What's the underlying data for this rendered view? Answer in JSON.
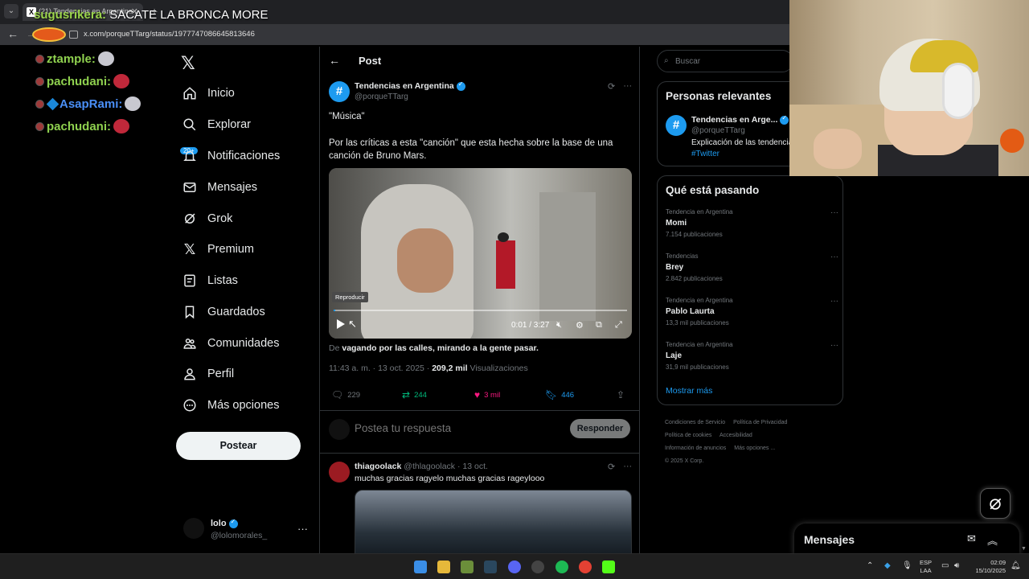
{
  "browser": {
    "tab_title": "(21) Tendencias en Argentina ...",
    "url": "x.com/porqueTTarg/status/1977747086645813646"
  },
  "stream_chat": {
    "top_user": "sugusrikera:",
    "top_message": "SACATE LA BRONCA MORE",
    "lines": [
      {
        "user": "ztample:"
      },
      {
        "user": "pachudani:"
      },
      {
        "user": "AsapRami:"
      },
      {
        "user": "pachudani:"
      }
    ]
  },
  "nav": {
    "items": [
      {
        "label": "Inicio",
        "icon": "home-icon"
      },
      {
        "label": "Explorar",
        "icon": "search-icon"
      },
      {
        "label": "Notificaciones",
        "icon": "bell-icon"
      },
      {
        "label": "Mensajes",
        "icon": "mail-icon"
      },
      {
        "label": "Grok",
        "icon": "grok-icon"
      },
      {
        "label": "Premium",
        "icon": "x-logo-icon"
      },
      {
        "label": "Listas",
        "icon": "list-icon"
      },
      {
        "label": "Guardados",
        "icon": "bookmark-icon"
      },
      {
        "label": "Comunidades",
        "icon": "people-icon"
      },
      {
        "label": "Perfil",
        "icon": "person-icon"
      },
      {
        "label": "Más opciones",
        "icon": "more-circle-icon"
      }
    ],
    "notif_badge": "20+",
    "post_button": "Postear",
    "account": {
      "name": "lolo",
      "handle": "@lolomorales_"
    }
  },
  "post": {
    "header": "Post",
    "author_name": "Tendencias en Argentina",
    "author_handle": "@porqueTTarg",
    "text1": "\"Música\"",
    "text2": "Por las críticas a esta \"canción\" que esta hecha sobre la base de una canción de Bruno Mars.",
    "video": {
      "tooltip": "Reproducir",
      "time": "0:01 / 3:27",
      "progress": 0.005
    },
    "from_prefix": "De",
    "from_source": "vagando por las calles, mirando a la gente pasar.",
    "timestamp": "11:43 a. m. · 13 oct. 2025 ·",
    "views_count": "209,2 mil",
    "views_label": "Visualizaciones",
    "replies": "229",
    "reposts": "244",
    "likes": "3 mil",
    "bookmarks": "446",
    "reply_placeholder": "Postea tu respuesta",
    "reply_button": "Responder"
  },
  "reply_post": {
    "name": "thiagoolack",
    "handle": "@thlagoolack · 13 oct.",
    "text": "muchas gracias ragyelo muchas gracias rageylooo"
  },
  "sidebar": {
    "search_placeholder": "Buscar",
    "relevant_title": "Personas relevantes",
    "relevant": {
      "name": "Tendencias en Arge...",
      "handle": "@porqueTTarg",
      "bio": "Explicación de las tendencias",
      "tag": "#Twitter"
    },
    "trends_title": "Qué está pasando",
    "trends": [
      {
        "context": "Tendencia en Argentina",
        "name": "Momi",
        "count": "7.154 publicaciones"
      },
      {
        "context": "Tendencias",
        "name": "Brey",
        "count": "2.842 publicaciones"
      },
      {
        "context": "Tendencia en Argentina",
        "name": "Pablo Laurta",
        "count": "13,3 mil publicaciones"
      },
      {
        "context": "Tendencia en Argentina",
        "name": "Laje",
        "count": "31,9 mil publicaciones"
      }
    ],
    "show_more": "Mostrar más",
    "footer": [
      "Condiciones de Servicio",
      "Política de Privacidad",
      "Política de cookies",
      "Accesibilidad",
      "Información de anuncios",
      "Más opciones ...",
      "© 2025 X Corp."
    ]
  },
  "messages_drawer": {
    "title": "Mensajes"
  },
  "taskbar": {
    "lang1": "ESP",
    "lang2": "LAA",
    "time": "02:09",
    "date": "15/10/2025"
  },
  "colors": {
    "accent": "#1d9bf0",
    "repost": "#00ba7c",
    "like": "#f91880",
    "chat_user": "#8fd14f"
  }
}
